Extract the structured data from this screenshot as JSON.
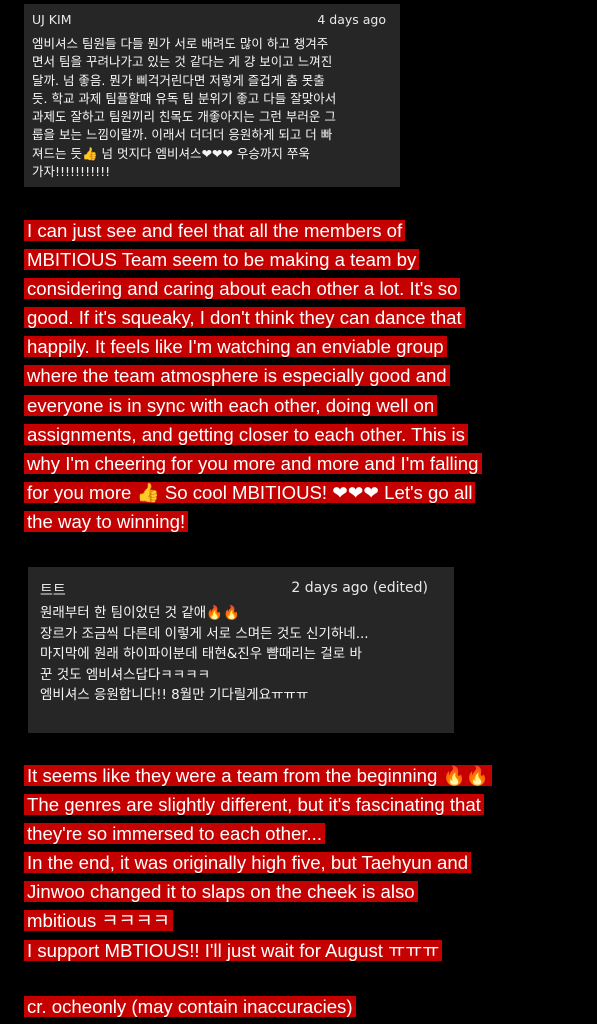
{
  "comment1": {
    "author": "UJ KIM",
    "time": "4 days ago",
    "text": "엠비셔스 팀원들 다들 뭔가 서로 배려도 많이 하고 챙겨주\n면서 팀을 꾸려나가고 있는 것 같다는 게 걍 보이고 느껴진\n달까. 넘 좋음. 뭔가 삐걱거린다면 저렇게 즐겁게 춤 못출\n듯. 학교 과제 팀플할때 유독 팀 분위기 좋고 다들 잘맞아서\n과제도 잘하고 팀원끼리 친목도 개좋아지는 그런 부러운 그\n룹을 보는 느낌이랄까. 이래서 더더더 응원하게 되고 더 빠\n져드는 듯👍 넘 멋지다 엠비셔스❤❤❤ 우승까지 쭈욱\n가자!!!!!!!!!!!"
  },
  "translation1": [
    "I can just see and feel that all the members of",
    "MBITIOUS Team seem to be making a team by",
    "considering and caring about each other a lot. It's so",
    "good. If it's squeaky, I don't think they can dance that",
    "happily. It feels like I'm watching an enviable group",
    "where the team atmosphere is especially good and",
    "everyone is in sync with each other, doing well on",
    "assignments, and getting closer to each other. This is",
    "why I'm cheering for you more and more and I'm falling",
    "for you more 👍 So cool MBITIOUS! ❤❤❤ Let's go all",
    "the way to winning!"
  ],
  "comment2": {
    "author": "트트",
    "time": "2 days ago (edited)",
    "text": "원래부터 한 팀이었던 것 같애🔥🔥\n장르가 조금씩 다른데 이렇게 서로 스며든 것도 신기하네...\n마지막에 원래 하이파이분데 태현&진우 뺨때리는 걸로 바\n꾼 것도 엠비셔스답다ㅋㅋㅋㅋ\n엠비셔스 응원합니다!! 8월만 기다릴게요ㅠㅠㅠ"
  },
  "translation2": [
    "It seems like they were a team from the beginning 🔥🔥",
    "The genres are slightly different, but it's fascinating that",
    "they're so immersed to each other...",
    "In the end, it was originally high five, but Taehyun and",
    "Jinwoo changed it to slaps on the cheek is also",
    "mbitious ㅋㅋㅋㅋ",
    "I support MBTIOUS!!  I'll just wait for August ㅠㅠㅠ"
  ],
  "credit": "cr. ocheonly (may contain inaccuracies)",
  "colors": {
    "highlight": "#c40000",
    "card": "#262626",
    "background": "#000000"
  }
}
